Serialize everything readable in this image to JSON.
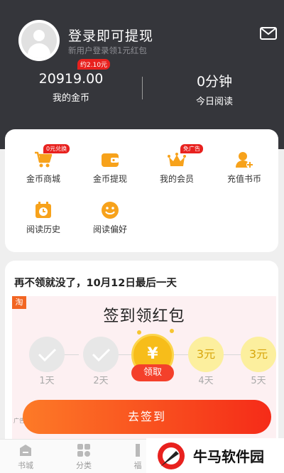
{
  "header": {
    "login_title": "登录即可提现",
    "login_subtitle": "新用户登录领1元红包",
    "icons": {
      "avatar": "user-avatar-icon",
      "mail": "mail-icon"
    }
  },
  "stats": {
    "coin_badge": "约2.10元",
    "coins_value": "20919.00",
    "coins_label": "我的金币",
    "read_value": "0分钟",
    "read_label": "今日阅读"
  },
  "menu": {
    "items": [
      {
        "label": "金币商城",
        "badge": "0元兑换",
        "icon": "cart-icon"
      },
      {
        "label": "金币提现",
        "badge": "",
        "icon": "wallet-icon"
      },
      {
        "label": "我的会员",
        "badge": "免广告",
        "icon": "crown-icon"
      },
      {
        "label": "充值书币",
        "badge": "",
        "icon": "add-user-icon"
      },
      {
        "label": "阅读历史",
        "badge": "",
        "icon": "calendar-clock-icon"
      },
      {
        "label": "阅读偏好",
        "badge": "",
        "icon": "smile-icon"
      }
    ]
  },
  "promo": {
    "title": "再不领就没了，10月12日最后一天",
    "ad_corner": "淘",
    "heading": "签到领红包",
    "days": [
      {
        "label": "1天",
        "state": "done"
      },
      {
        "label": "2天",
        "state": "done"
      },
      {
        "label": "",
        "state": "today"
      },
      {
        "label": "4天",
        "state": "pending",
        "amount": "3元"
      },
      {
        "label": "5天",
        "state": "pending",
        "amount": "3元"
      }
    ],
    "coin_symbol": "¥",
    "claim_label": "领取",
    "ad_tag": "广告",
    "signin_label": "去签到"
  },
  "tabbar": {
    "items": [
      {
        "label": "书城",
        "icon": "bookshelf-icon"
      },
      {
        "label": "分类",
        "icon": "grid-icon"
      },
      {
        "label": "福",
        "icon": "gift-icon"
      }
    ]
  },
  "watermark": {
    "text": "牛马软件园"
  },
  "colors": {
    "header_bg": "#35363b",
    "accent_red": "#e8211e",
    "accent_orange": "#f7a21b",
    "button_gradient_start": "#fd7a27",
    "button_gradient_end": "#f52b18"
  }
}
